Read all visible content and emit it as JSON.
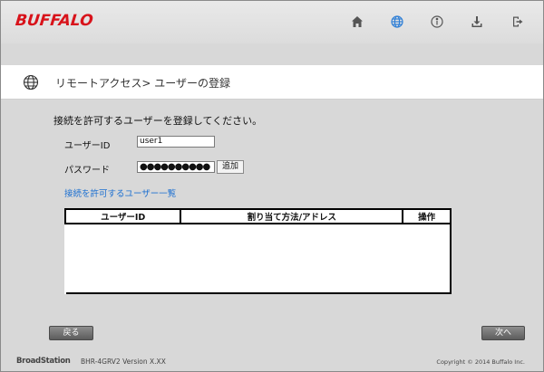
{
  "header": {
    "logo": "BUFFALO",
    "icons": [
      "home-icon",
      "globe-icon",
      "info-icon",
      "download-icon",
      "logout-icon"
    ]
  },
  "page": {
    "title": "リモートアクセス> ユーザーの登録",
    "title_icon": "globe-icon"
  },
  "form": {
    "lead": "接続を許可するユーザーを登録してください。",
    "user_id_label": "ユーザーID",
    "user_id_value": "user1",
    "password_label": "パスワード",
    "password_value": "●●●●●●●●●●",
    "add_button": "追加",
    "allowed_users_link": "接続を許可するユーザー一覧"
  },
  "table": {
    "columns": [
      "ユーザーID",
      "割り当て方法/アドレス",
      "操作"
    ],
    "rows": []
  },
  "buttons": {
    "back": "戻る",
    "next": "次へ"
  },
  "footer": {
    "brand": "BroadStation",
    "model": "BHR-4GRV2   Version  X.XX",
    "copyright": "Copyright © 2014 Buffalo Inc."
  },
  "colors": {
    "logo": "#d8131b",
    "nav_icon": "#555555",
    "nav_icon_active": "#2f7fd6",
    "link": "#1b6fd1"
  }
}
